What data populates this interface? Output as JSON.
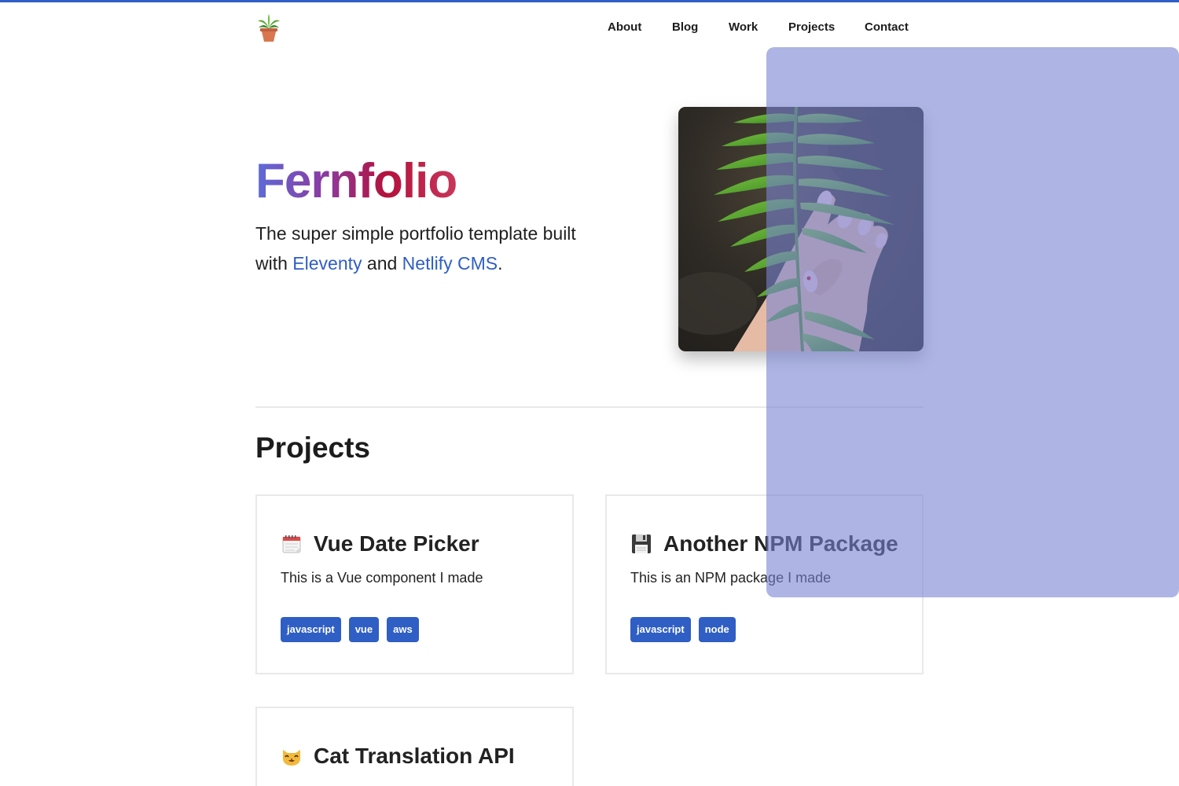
{
  "site": {
    "accent_color": "#2f5ec4",
    "logo_icon": "potted-plant-icon"
  },
  "nav": {
    "items": [
      {
        "label": "About"
      },
      {
        "label": "Blog"
      },
      {
        "label": "Work"
      },
      {
        "label": "Projects"
      },
      {
        "label": "Contact"
      }
    ]
  },
  "hero": {
    "title": "Fernfolio",
    "text_before": "The super simple portfolio template built with ",
    "link1": "Eleventy",
    "text_middle": " and ",
    "link2": "Netlify CMS",
    "text_after": ".",
    "photo_description_icon": "fern-in-hand-photo"
  },
  "projects": {
    "heading": "Projects",
    "cards": [
      {
        "icon": "calendar-icon",
        "title": "Vue Date Picker",
        "description": "This is a Vue component I made",
        "tags": [
          "javascript",
          "vue",
          "aws"
        ]
      },
      {
        "icon": "floppy-disk-icon",
        "title": "Another NPM Package",
        "description": "This is an NPM package I made",
        "tags": [
          "javascript",
          "node"
        ]
      },
      {
        "icon": "cat-face-icon",
        "title": "Cat Translation API",
        "description": "",
        "tags": []
      }
    ]
  }
}
